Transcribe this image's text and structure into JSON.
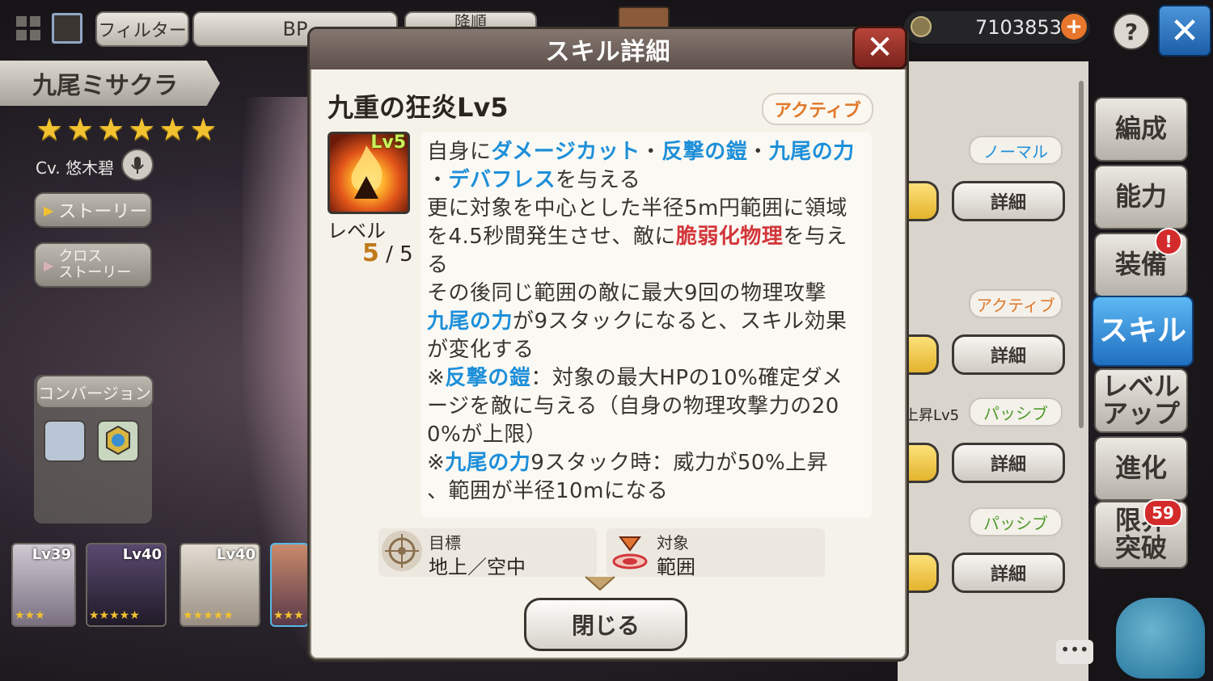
{
  "topbar": {
    "filter_label": "フィルター",
    "sort_key_label": "BP",
    "sort_order_label": "降順",
    "currency_amount": "7103853",
    "help_label": "?",
    "close_label": "✕"
  },
  "character": {
    "name": "九尾ミサクラ",
    "stars": [
      "★",
      "★",
      "★",
      "★",
      "★",
      "★"
    ],
    "cv": "Cv. 悠木碧",
    "story_label": "ストーリー",
    "cross_story_label": "クロス\nストーリー",
    "conversion_label": "コンバージョン"
  },
  "roster": [
    {
      "level": "Lv39",
      "stars": "★★★"
    },
    {
      "level": "Lv40",
      "stars": "★★★★★"
    },
    {
      "level": "Lv40",
      "stars": "★★★★★"
    },
    {
      "level": "",
      "stars": "★★★"
    }
  ],
  "side_menu": {
    "formation": "編成",
    "ability": "能力",
    "equipment": "装備",
    "skill": "スキル",
    "level_up": "レベル\nアップ",
    "evolution": "進化",
    "limit_break": "限界\n突破",
    "limit_break_badge": "59",
    "equipment_badge": "!"
  },
  "skill_list": {
    "tags": [
      "ノーマル",
      "アクティブ",
      "パッシブ",
      "パッシブ"
    ],
    "partial_text": "上昇Lv5",
    "detail_label": "詳細"
  },
  "modal": {
    "header": "スキル詳細",
    "skill_name": "九重の狂炎Lv5",
    "skill_type": "アクティブ",
    "icon_level": "Lv5",
    "level_label": "レベル",
    "level_current": "5",
    "level_max": "5",
    "target_label": "目標",
    "target_value": "地上／空中",
    "scope_label": "対象",
    "scope_value": "範囲",
    "close_label": "閉じる"
  },
  "colors": {
    "highlight_blue": "#1d8fd9",
    "highlight_red": "#d3363a",
    "active_orange": "#e0782a",
    "skill_menu_blue": "#2f86d6"
  }
}
